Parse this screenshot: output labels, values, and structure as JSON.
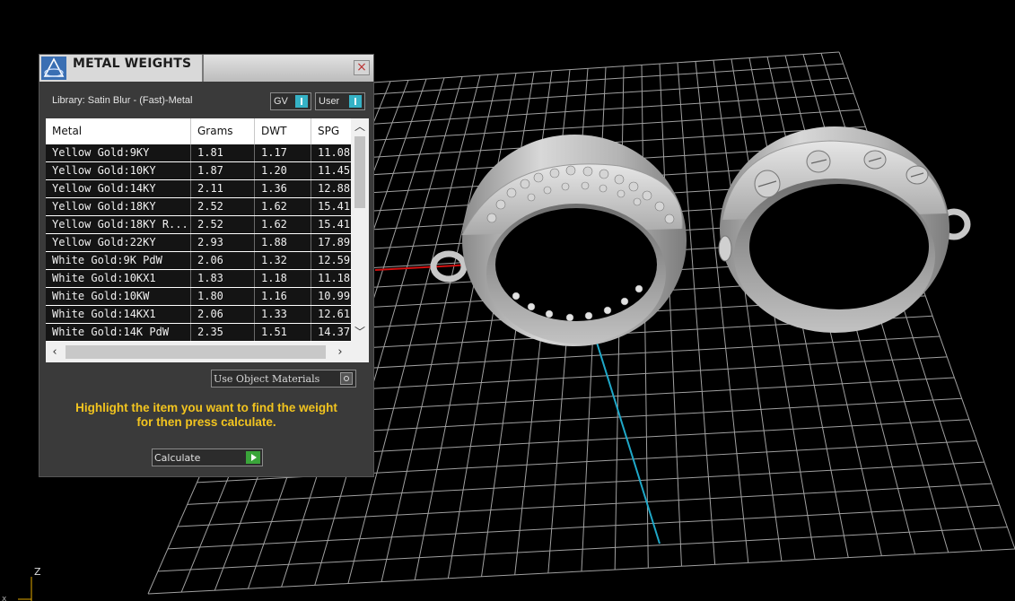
{
  "panel": {
    "title": "METAL WEIGHTS",
    "close_icon": "×",
    "library_label": "Library: Satin Blur - (Fast)-Metal",
    "toggle_gv": "GV",
    "toggle_user": "User",
    "columns": [
      "Metal",
      "Grams",
      "DWT",
      "SPG"
    ],
    "rows": [
      [
        "Yellow Gold:9KY",
        "1.81",
        "1.17",
        "11.08"
      ],
      [
        "Yellow Gold:10KY",
        "1.87",
        "1.20",
        "11.45"
      ],
      [
        "Yellow Gold:14KY",
        "2.11",
        "1.36",
        "12.88"
      ],
      [
        "Yellow Gold:18KY",
        "2.52",
        "1.62",
        "15.41"
      ],
      [
        "Yellow Gold:18KY R...",
        "2.52",
        "1.62",
        "15.41"
      ],
      [
        "Yellow Gold:22KY",
        "2.93",
        "1.88",
        "17.89"
      ],
      [
        "White Gold:9K PdW",
        "2.06",
        "1.32",
        "12.59"
      ],
      [
        "White Gold:10KX1",
        "1.83",
        "1.18",
        "11.18"
      ],
      [
        "White Gold:10KW",
        "1.80",
        "1.16",
        "10.99"
      ],
      [
        "White Gold:14KX1",
        "2.06",
        "1.33",
        "12.61"
      ],
      [
        "White Gold:14K PdW",
        "2.35",
        "1.51",
        "14.37"
      ]
    ],
    "use_object_materials": "Use Object Materials",
    "hint_line1": "Highlight the item you want to find the weight",
    "hint_line2": "for then press calculate.",
    "calculate_label": "Calculate"
  },
  "viewport": {
    "axis_label_z": "Z",
    "axis_label_x": "x"
  },
  "colors": {
    "hint": "#f2c41f",
    "toggle": "#35b2c6",
    "go": "#3aa53a",
    "axis_x": "#d01010",
    "axis_y": "#1fa8c8"
  }
}
